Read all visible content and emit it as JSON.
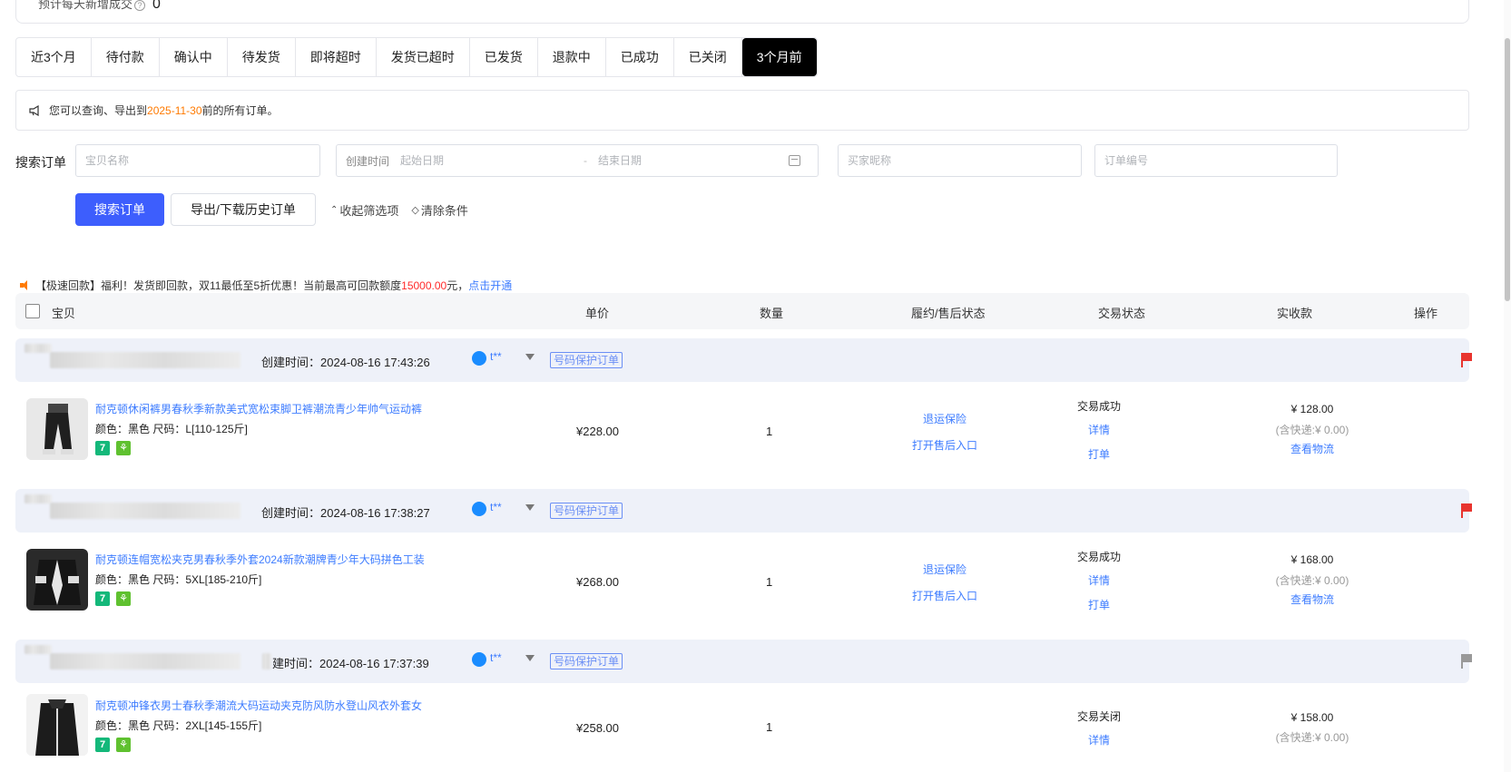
{
  "top": {
    "label": "预计每天新增成交",
    "value": "0"
  },
  "tabs": [
    "近3个月",
    "待付款",
    "确认中",
    "待发货",
    "即将超时",
    "发货已超时",
    "已发货",
    "退款中",
    "已成功",
    "已关闭",
    "3个月前"
  ],
  "active_tab": "3个月前",
  "notice": {
    "prefix": "您可以查询、导出到 ",
    "date": "2025-11-30",
    "suffix": " 前的所有订单。"
  },
  "search": {
    "label": "搜索订单",
    "item_placeholder": "宝贝名称",
    "date_label": "创建时间",
    "start_placeholder": "起始日期",
    "sep": "-",
    "end_placeholder": "结束日期",
    "buyer_placeholder": "买家昵称",
    "order_placeholder": "订单编号"
  },
  "buttons": {
    "search": "搜索订单",
    "export": "导出/下载历史订单",
    "collapse": "收起筛选项",
    "clear": "清除条件"
  },
  "promo": {
    "p1": "【极速回款】福利！发货即回款，双11最低至5折优惠！当前最高可回款额度",
    "amount": "15000.00",
    "p2": "元，",
    "link": "点击开通"
  },
  "table_head": {
    "item": "宝贝",
    "unit_price": "单价",
    "qty": "数量",
    "after_sale": "履约/售后状态",
    "trade_status": "交易状态",
    "received": "实收款",
    "ops": "操作"
  },
  "orders": [
    {
      "created": "创建时间：2024-08-16 17:43:26",
      "buyer": "t**",
      "tag": "号码保护订单",
      "flag_color": "#e8342e",
      "title": "耐克顿休闲裤男春秋季新款美式宽松束脚卫裤潮流青少年帅气运动裤",
      "spec": "颜色：黑色   尺码：L[110-125斤]",
      "price": "¥228.00",
      "qty": "1",
      "after1": "退运保险",
      "after2": "打开售后入口",
      "status": "交易成功",
      "detail": "详情",
      "print": "打单",
      "received": "¥ 128.00",
      "shipping": "(含快递:¥ 0.00)",
      "logistics": "查看物流"
    },
    {
      "created": "创建时间：2024-08-16 17:38:27",
      "buyer": "t**",
      "tag": "号码保护订单",
      "flag_color": "#e8342e",
      "title": "耐克顿连帽宽松夹克男春秋季外套2024新款潮牌青少年大码拼色工装",
      "spec": "颜色：黑色   尺码：5XL[185-210斤]",
      "price": "¥268.00",
      "qty": "1",
      "after1": "退运保险",
      "after2": "打开售后入口",
      "status": "交易成功",
      "detail": "详情",
      "print": "打单",
      "received": "¥ 168.00",
      "shipping": "(含快递:¥ 0.00)",
      "logistics": "查看物流"
    },
    {
      "created": "建时间：2024-08-16 17:37:39",
      "buyer": "t**",
      "tag": "号码保护订单",
      "flag_color": "#999999",
      "title": "耐克顿冲锋衣男士春秋季潮流大码运动夹克防风防水登山风衣外套女",
      "spec": "颜色：黑色   尺码：2XL[145-155斤]",
      "price": "¥258.00",
      "qty": "1",
      "status": "交易关闭",
      "detail": "详情",
      "received": "¥ 158.00",
      "shipping": "(含快递:¥ 0.00)"
    }
  ],
  "badges": {
    "b1": "7",
    "b2": "⚘"
  }
}
